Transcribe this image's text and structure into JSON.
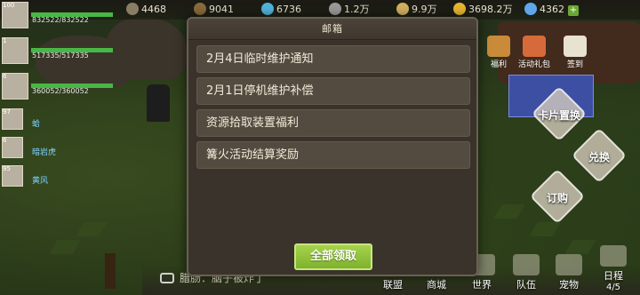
{
  "resources": [
    {
      "name": "stamina",
      "value": "4468",
      "color": "#8a7d66"
    },
    {
      "name": "wood",
      "value": "9041",
      "color": "#8a6a3b"
    },
    {
      "name": "crystal",
      "value": "6736",
      "color": "#4fb4d9"
    },
    {
      "name": "stone",
      "value": "1.2万",
      "color": "#9a9a9a"
    },
    {
      "name": "food",
      "value": "9.9万",
      "color": "#d2b060"
    },
    {
      "name": "gold",
      "value": "3698.2万",
      "color": "#e8b52f"
    },
    {
      "name": "diamond",
      "value": "4362",
      "color": "#5fa7e8"
    }
  ],
  "team": [
    {
      "level": "100",
      "hp_text": "832522/832522",
      "hp_ratio": 1.0,
      "name": ""
    },
    {
      "level": "1",
      "hp_text": "517335/517335",
      "hp_ratio": 1.0,
      "name": ""
    },
    {
      "level": "6",
      "hp_text": "360052/360052",
      "hp_ratio": 1.0,
      "name": ""
    },
    {
      "level": "97",
      "hp_text": "",
      "hp_ratio": 1.0,
      "name": "蛤"
    },
    {
      "level": "6",
      "hp_text": "",
      "hp_ratio": 1.0,
      "name": "暗岩虎"
    },
    {
      "level": "95",
      "hp_text": "",
      "hp_ratio": 1.0,
      "name": "黄风"
    }
  ],
  "side_icons": [
    {
      "label": "福利",
      "color": "#c98a3a"
    },
    {
      "label": "活动礼包",
      "color": "#d76a3a"
    },
    {
      "label": "签到",
      "color": "#e8e2d0"
    }
  ],
  "actions": {
    "card_swap": "卡片置换",
    "exchange": "兑换",
    "subscribe": "订购"
  },
  "chat": {
    "text": "腊肠：脑子被炸了"
  },
  "nav": {
    "alliance": "联盟",
    "shop": "商城",
    "world": "世界",
    "team": "队伍",
    "pet": "宠物",
    "daily": "日程",
    "daily_count": "4/5"
  },
  "mailbox": {
    "title": "邮箱",
    "mails": [
      "2月4日临时维护通知",
      "2月1日停机维护补偿",
      "资源拾取装置福利",
      "篝火活动结算奖励"
    ],
    "claim_all": "全部领取"
  }
}
